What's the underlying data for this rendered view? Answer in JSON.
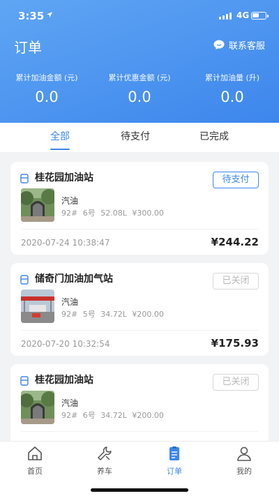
{
  "status_bar": {
    "time": "3:35",
    "network": "4G"
  },
  "header": {
    "title": "订单",
    "customer_service": "联系客服",
    "stats": [
      {
        "label": "累计加油金额 (元)",
        "value": "0.0"
      },
      {
        "label": "累计优惠金额 (元)",
        "value": "0.0"
      },
      {
        "label": "累计加油量 (升)",
        "value": "0.0"
      }
    ]
  },
  "tabs": [
    {
      "label": "全部"
    },
    {
      "label": "待支付"
    },
    {
      "label": "已完成"
    }
  ],
  "orders": [
    {
      "station": "桂花园加油站",
      "status": "待支付",
      "fuel": "汽油",
      "grade": "92#",
      "pump": "6号",
      "volume": "52.08L",
      "price": "¥300.00",
      "date": "2020-07-24 10:38:47",
      "amount": "¥244.22"
    },
    {
      "station": "储奇门加油加气站",
      "status": "已关闭",
      "fuel": "汽油",
      "grade": "92#",
      "pump": "5号",
      "volume": "34.72L",
      "price": "¥200.00",
      "date": "2020-07-20 10:32:54",
      "amount": "¥175.93"
    },
    {
      "station": "桂花园加油站",
      "status": "已关闭",
      "fuel": "汽油",
      "grade": "92#",
      "pump": "6号",
      "volume": "34.72L",
      "price": "¥200.00",
      "date": "",
      "amount": ""
    }
  ],
  "bottom_nav": [
    {
      "label": "首页",
      "icon": "home-icon"
    },
    {
      "label": "养车",
      "icon": "wrench-icon"
    },
    {
      "label": "订单",
      "icon": "order-icon"
    },
    {
      "label": "我的",
      "icon": "profile-icon"
    }
  ],
  "colors": {
    "accent": "#3d86ec",
    "header_gradient_start": "#5fa6f4"
  }
}
